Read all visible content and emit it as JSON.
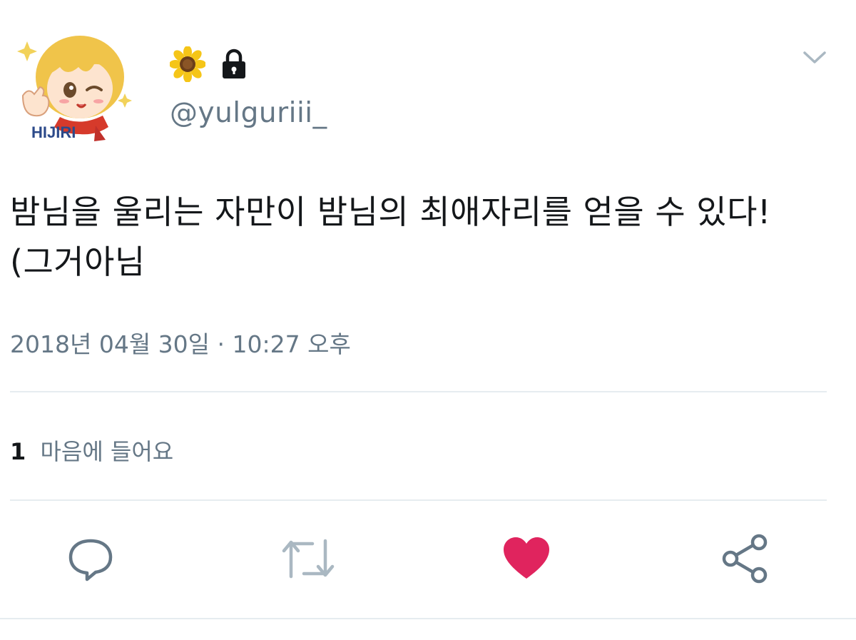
{
  "user": {
    "handle": "@yulguriii_",
    "avatar_text": "HIJIRI",
    "name_icons": [
      "sunflower-icon",
      "lock-icon"
    ]
  },
  "tweet": {
    "text": "밤님을 울리는 자만이 밤님의 최애자리를 얻을 수 있다!\n(그거아님",
    "timestamp": "2018년 04월 30일 · 10:27 오후"
  },
  "stats": {
    "likes_count": "1",
    "likes_label": "마음에 들어요"
  },
  "actions": [
    {
      "icon": "reply-icon"
    },
    {
      "icon": "retweet-icon"
    },
    {
      "icon": "heart-icon",
      "active": true,
      "color": "#e0245e"
    },
    {
      "icon": "share-icon"
    }
  ],
  "colors": {
    "text": "#14171a",
    "secondary": "#657786",
    "divider": "#e6ecf0",
    "liked": "#e0245e",
    "retweet_disabled": "#aab8c2"
  }
}
